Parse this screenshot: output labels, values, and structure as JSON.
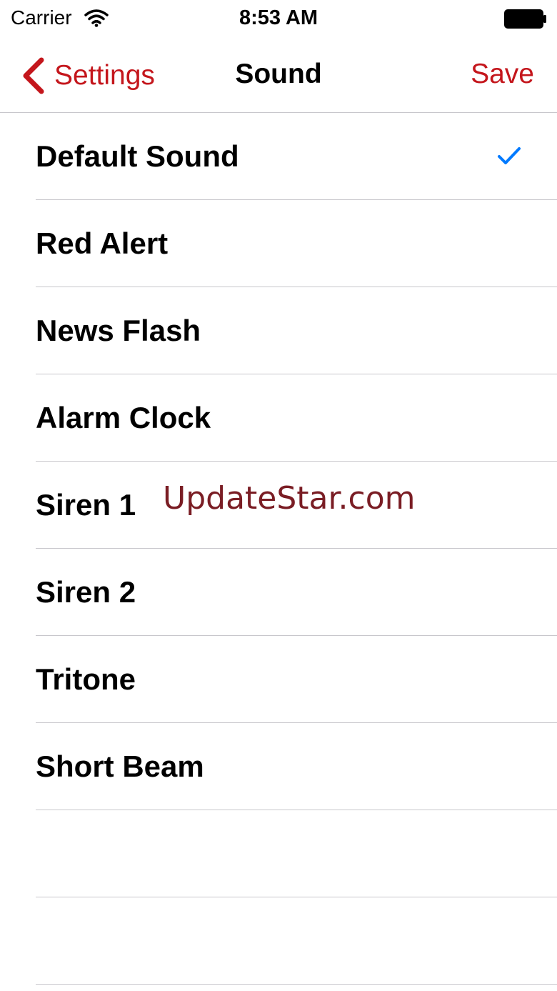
{
  "status_bar": {
    "carrier": "Carrier",
    "time": "8:53 AM",
    "icons": [
      "wifi-icon",
      "battery-icon"
    ]
  },
  "nav": {
    "back_label": "Settings",
    "title": "Sound",
    "save_label": "Save",
    "accent_color": "#c4161c"
  },
  "sounds": {
    "items": [
      {
        "label": "Default Sound",
        "selected": true
      },
      {
        "label": "Red Alert",
        "selected": false
      },
      {
        "label": "News Flash",
        "selected": false
      },
      {
        "label": "Alarm Clock",
        "selected": false
      },
      {
        "label": "Siren 1",
        "selected": false
      },
      {
        "label": "Siren 2",
        "selected": false
      },
      {
        "label": "Tritone",
        "selected": false
      },
      {
        "label": "Short Beam",
        "selected": false
      }
    ],
    "check_color": "#007aff"
  },
  "watermark": "UpdateStar.com"
}
